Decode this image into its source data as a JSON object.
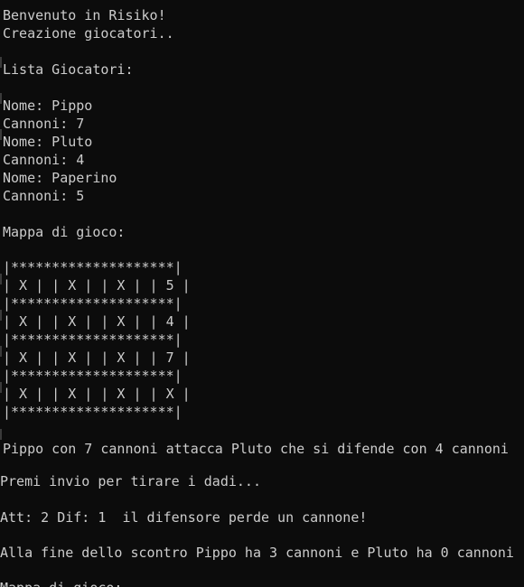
{
  "console": {
    "header": {
      "welcome": "Benvenuto in Risiko!",
      "creating": "Creazione giocatori.."
    },
    "players_title": "Lista Giocatori:",
    "players": [
      {
        "name_line": "Nome: Pippo",
        "cannons_line": "Cannoni: 7"
      },
      {
        "name_line": "Nome: Pluto",
        "cannons_line": "Cannoni: 4"
      },
      {
        "name_line": "Nome: Paperino",
        "cannons_line": "Cannoni: 5"
      }
    ],
    "map_title": "Mappa di gioco:",
    "map_rows": [
      "|********************|",
      "| X | | X | | X | | 5 |",
      "|********************|",
      "| X | | X | | X | | 4 |",
      "|********************|",
      "| X | | X | | X | | 7 |",
      "|********************|",
      "| X | | X | | X | | X |",
      "|********************|"
    ],
    "attack": "Pippo con 7 cannoni attacca Pluto che si difende con 4 cannoni",
    "prompt": "Premi invio per tirare i dadi...",
    "roll_result": "Att: 2 Dif: 1  il difensore perde un cannone!",
    "battle_end": "Alla fine dello scontro Pippo ha 3 cannoni e Pluto ha 0 cannoni",
    "partial": "Mappa di gioco:"
  }
}
